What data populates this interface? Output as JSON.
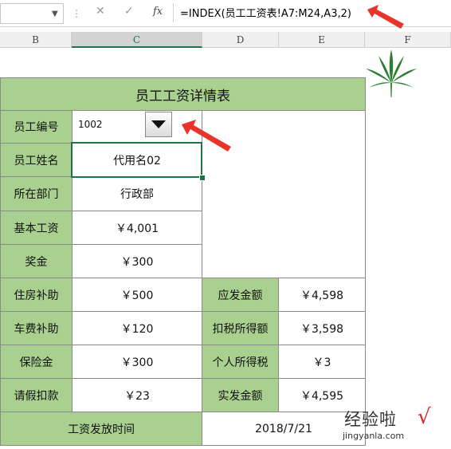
{
  "formula_bar": {
    "formula": "=INDEX(员工工资表!A7:M24,A3,2)",
    "cancel_glyph": "✕",
    "enter_glyph": "✓",
    "fx_label": "fx"
  },
  "columns": [
    "B",
    "C",
    "D",
    "E",
    "F"
  ],
  "sheet": {
    "title": "员工工资详情表",
    "employee_id_label": "员工编号",
    "employee_id_value": "1002",
    "rows": [
      {
        "label": "员工姓名",
        "value": "代用名02"
      },
      {
        "label": "所在部门",
        "value": "行政部"
      },
      {
        "label": "基本工资",
        "value": "￥4,001"
      },
      {
        "label": "奖金",
        "value": "￥300"
      },
      {
        "label": "住房补助",
        "value": "￥500"
      },
      {
        "label": "车费补助",
        "value": "￥120"
      },
      {
        "label": "保险金",
        "value": "￥300"
      },
      {
        "label": "请假扣款",
        "value": "￥23"
      }
    ],
    "summary": [
      {
        "label": "应发金额",
        "value": "￥4,598"
      },
      {
        "label": "扣税所得额",
        "value": "￥3,598"
      },
      {
        "label": "个人所得税",
        "value": "￥3"
      },
      {
        "label": "实发金额",
        "value": "￥4,595"
      }
    ],
    "pay_date_label": "工资发放时间",
    "pay_date_value": "2018/7/21"
  },
  "watermark": {
    "text": "经验啦",
    "check": "√",
    "url": "jingyanla.com"
  },
  "colors": {
    "header_green": "#a9d08e",
    "select_green": "#217346",
    "arrow_red": "#e8342a",
    "leaf_green": "#2e7d32"
  },
  "icons": {
    "dropdown": "triangle-down-icon",
    "leaf": "cannabis-leaf-icon",
    "arrow": "red-arrow-icon"
  }
}
